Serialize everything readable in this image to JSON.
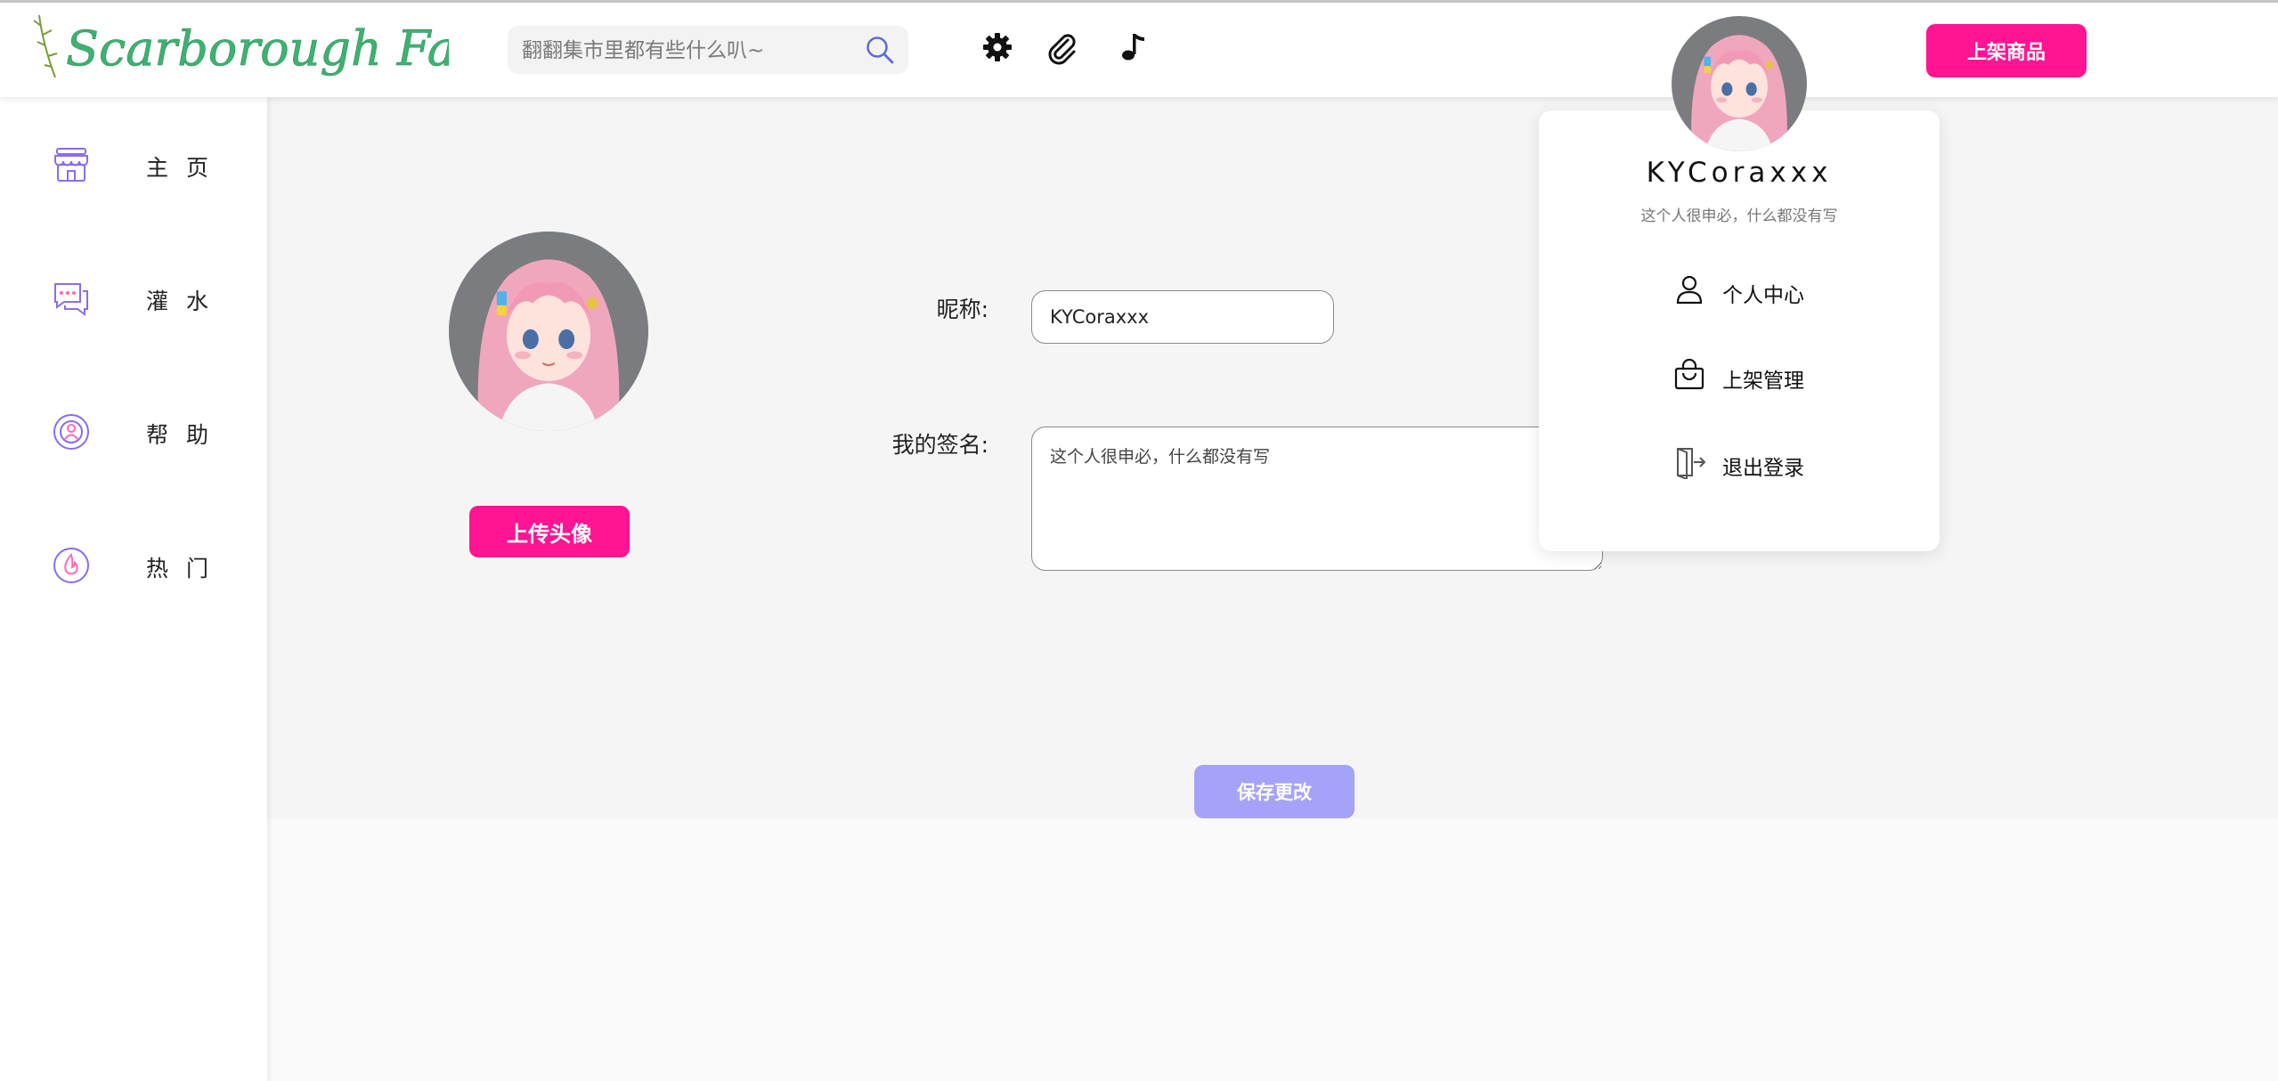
{
  "header": {
    "logo_text": "Scarborough Fair",
    "search": {
      "placeholder": "翻翻集市里都有些什么叭~"
    },
    "publish_label": "上架商品"
  },
  "sidebar": {
    "items": [
      {
        "label": "主 页",
        "icon": "shop-icon"
      },
      {
        "label": "灌 水",
        "icon": "chat-icon"
      },
      {
        "label": "帮 助",
        "icon": "help-icon"
      },
      {
        "label": "热 门",
        "icon": "fire-icon"
      }
    ]
  },
  "profile_form": {
    "upload_label": "上传头像",
    "nickname_label": "昵称:",
    "nickname_value": "KYCoraxxx",
    "signature_label": "我的签名:",
    "signature_value": "这个人很申必，什么都没有写",
    "save_label": "保存更改"
  },
  "user_menu": {
    "username": "KYCoraxxx",
    "signature": "这个人很申必，什么都没有写",
    "items": [
      {
        "label": "个人中心",
        "icon": "user-icon"
      },
      {
        "label": "上架管理",
        "icon": "shopping-bag-icon"
      },
      {
        "label": "退出登录",
        "icon": "logout-icon"
      }
    ]
  },
  "colors": {
    "accent_pink": "#ff1493",
    "save_purple": "#a5a3f8",
    "sidebar_icon_purple": "#8a6cf0",
    "logo_green": "#3cb371"
  }
}
